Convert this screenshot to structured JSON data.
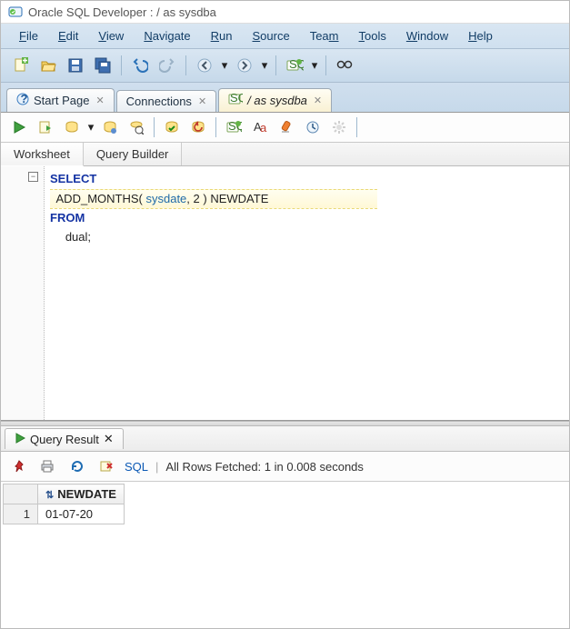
{
  "title": "Oracle SQL Developer : / as sysdba",
  "menu": [
    "File",
    "Edit",
    "View",
    "Navigate",
    "Run",
    "Source",
    "Team",
    "Tools",
    "Window",
    "Help"
  ],
  "tabs": {
    "start": "Start Page",
    "connections": "Connections",
    "session": "/ as sysdba"
  },
  "subtabs": {
    "worksheet": "Worksheet",
    "query_builder": "Query Builder"
  },
  "sql": {
    "l1": "SELECT",
    "l2_fn": "ADD_MONTHS",
    "l2_open": "( ",
    "l2_arg1": "sysdate",
    "l2_comma": ", ",
    "l2_arg2": "2",
    "l2_close": " ) ",
    "l2_alias": "NEWDATE",
    "l3": "FROM",
    "l4": "dual;"
  },
  "query_result": {
    "tab_label": "Query Result",
    "sql_link": "SQL",
    "status": "All Rows Fetched: 1 in 0.008 seconds",
    "column": "NEWDATE",
    "rownum": "1",
    "value": "01-07-20"
  }
}
